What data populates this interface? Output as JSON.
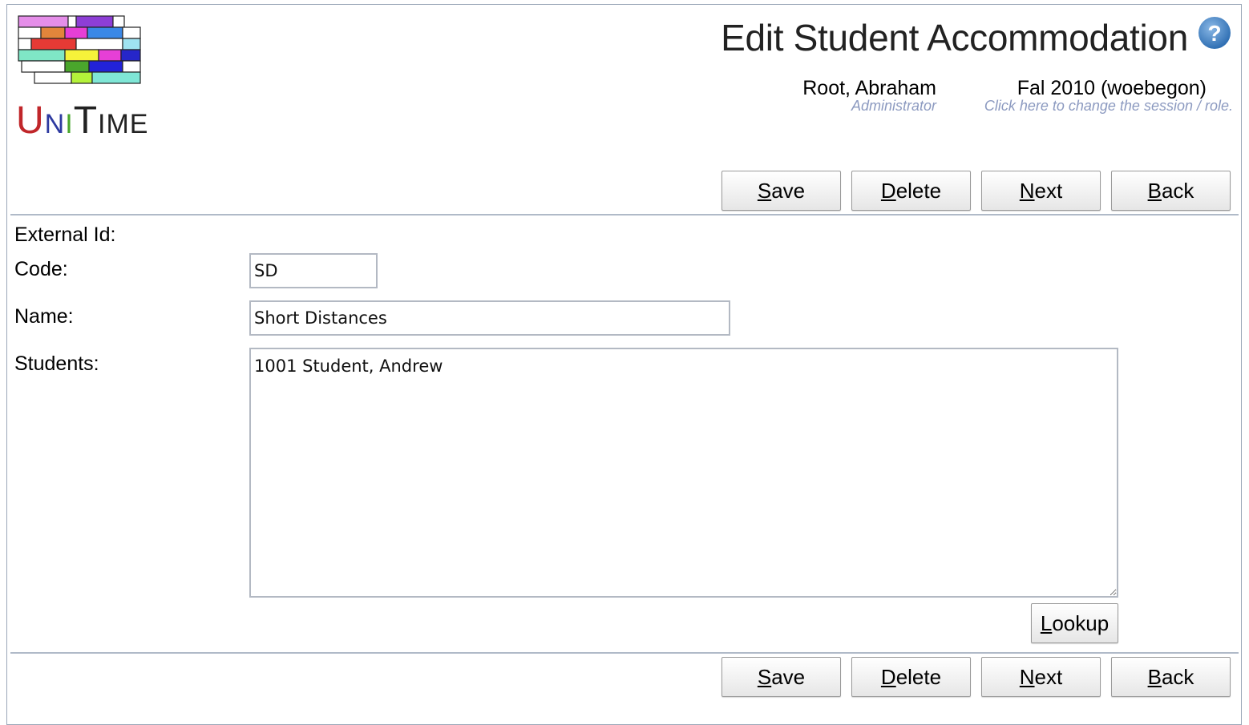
{
  "app": {
    "logo_text": "UniTime",
    "page_title": "Edit Student Accommodation",
    "help_icon": "help-question-icon"
  },
  "header": {
    "user_name": "Root, Abraham",
    "user_role": "Administrator",
    "session_name": "Fal 2010 (woebegon)",
    "session_hint": "Click here to change the session / role."
  },
  "toolbar": {
    "save": {
      "accesskey": "S",
      "rest": "ave"
    },
    "delete": {
      "accesskey": "D",
      "rest": "elete"
    },
    "next": {
      "accesskey": "N",
      "rest": "ext"
    },
    "back": {
      "accesskey": "B",
      "rest": "ack"
    }
  },
  "form": {
    "external_id_label": "External Id:",
    "code_label": "Code:",
    "code_value": "SD",
    "name_label": "Name:",
    "name_value": "Short Distances",
    "students_label": "Students:",
    "students_value": "1001 Student, Andrew",
    "lookup": {
      "accesskey": "L",
      "rest": "ookup"
    }
  },
  "colors": {
    "accent": "#8c9ac0",
    "border": "#b0bac8",
    "help_blue": "#3d7fc2"
  }
}
